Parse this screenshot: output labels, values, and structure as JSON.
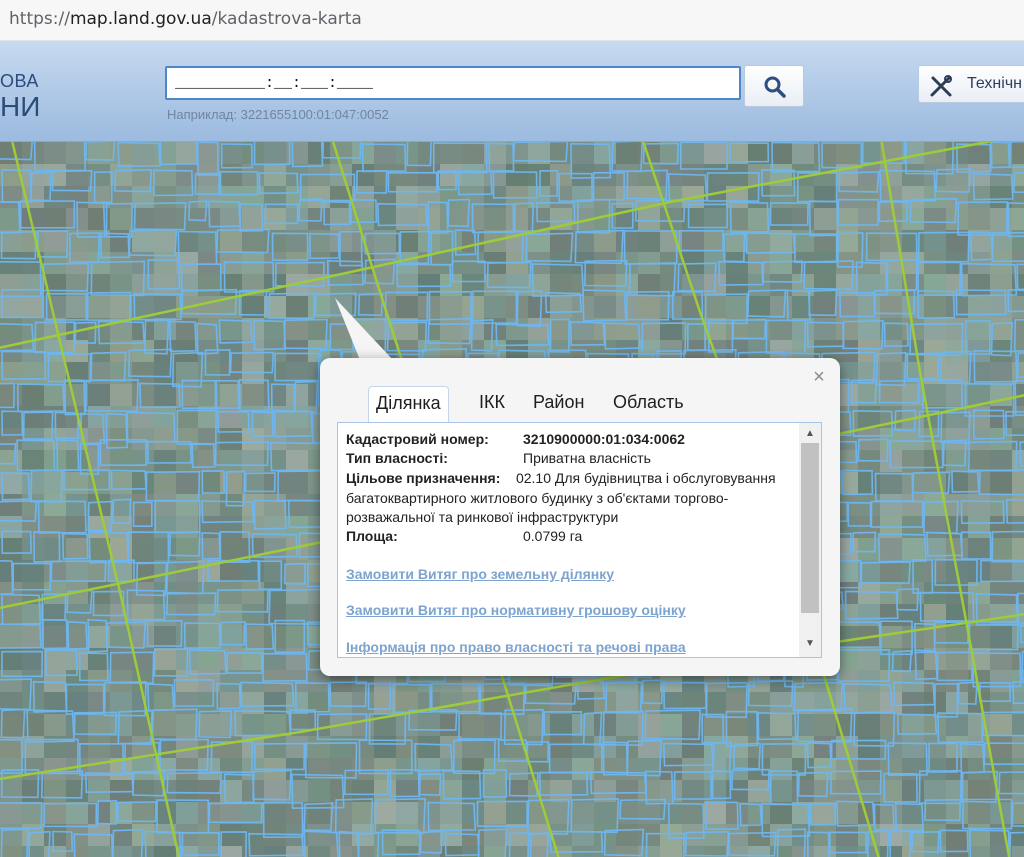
{
  "browser": {
    "url_prefix": "https://",
    "url_host": "map.land.gov.ua",
    "url_path": "/kadastrova-karta"
  },
  "header": {
    "logo_line1": "ОВА",
    "logo_line2": "НИ",
    "search_value": "__________:__:___:____",
    "search_hint": "Наприклад: 3221655100:01:047:0052",
    "search_icon": "magnifier-icon",
    "tech_label": "Технічн",
    "tech_icon": "tools-icon"
  },
  "popup": {
    "close": "×",
    "tabs": [
      {
        "label": "Ділянка",
        "active": true
      },
      {
        "label": "ІКК",
        "active": false
      },
      {
        "label": "Район",
        "active": false
      },
      {
        "label": "Область",
        "active": false
      }
    ],
    "details": {
      "cadastral_label": "Кадастровий номер:",
      "cadastral_value": "3210900000:01:034:0062",
      "ownership_label": "Тип власності:",
      "ownership_value": "Приватна власність",
      "purpose_label": "Цільове призначення:",
      "purpose_value": "02.10 Для будівництва і обслуговування багатоквартирного житлового будинку з об'єктами торгово-розважальної та ринкової інфраструктури",
      "area_label": "Площа:",
      "area_value": "0.0799 га"
    },
    "links": [
      "Замовити Витяг про земельну ділянку",
      "Замовити Витяг про нормативну грошову оцінку",
      "Інформація про право власності та речові права"
    ]
  },
  "colors": {
    "parcel_outline": "#6fb7f0",
    "road_line": "#9ecb3a",
    "link": "#7da3cf"
  }
}
